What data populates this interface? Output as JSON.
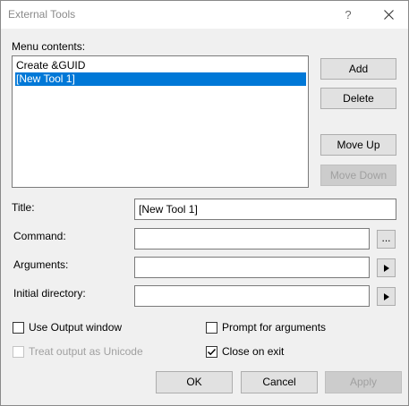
{
  "window": {
    "title": "External Tools",
    "help_glyph": "?"
  },
  "menu": {
    "label": "Menu contents:",
    "items": [
      {
        "label": "Create &GUID",
        "selected": false
      },
      {
        "label": "[New Tool 1]",
        "selected": true
      }
    ]
  },
  "side_buttons": {
    "add": "Add",
    "delete": "Delete",
    "move_up": "Move Up",
    "move_down": "Move Down"
  },
  "fields": {
    "title_label": "Title:",
    "title_value": "[New Tool 1]",
    "command_label": "Command:",
    "command_value": "",
    "browse_label": "...",
    "arguments_label": "Arguments:",
    "arguments_value": "",
    "initial_dir_label": "Initial directory:",
    "initial_dir_value": ""
  },
  "options": {
    "use_output_window": {
      "label": "Use Output window",
      "checked": false,
      "enabled": true
    },
    "prompt_for_arguments": {
      "label": "Prompt for arguments",
      "checked": false,
      "enabled": true
    },
    "treat_output_unicode": {
      "label": "Treat output as Unicode",
      "checked": false,
      "enabled": false
    },
    "close_on_exit": {
      "label": "Close on exit",
      "checked": true,
      "enabled": true
    }
  },
  "footer": {
    "ok": "OK",
    "cancel": "Cancel",
    "apply": "Apply"
  },
  "colors": {
    "selection": "#0078d7",
    "dialog_bg": "#f0f0f0",
    "disabled_text": "#a0a0a0"
  }
}
